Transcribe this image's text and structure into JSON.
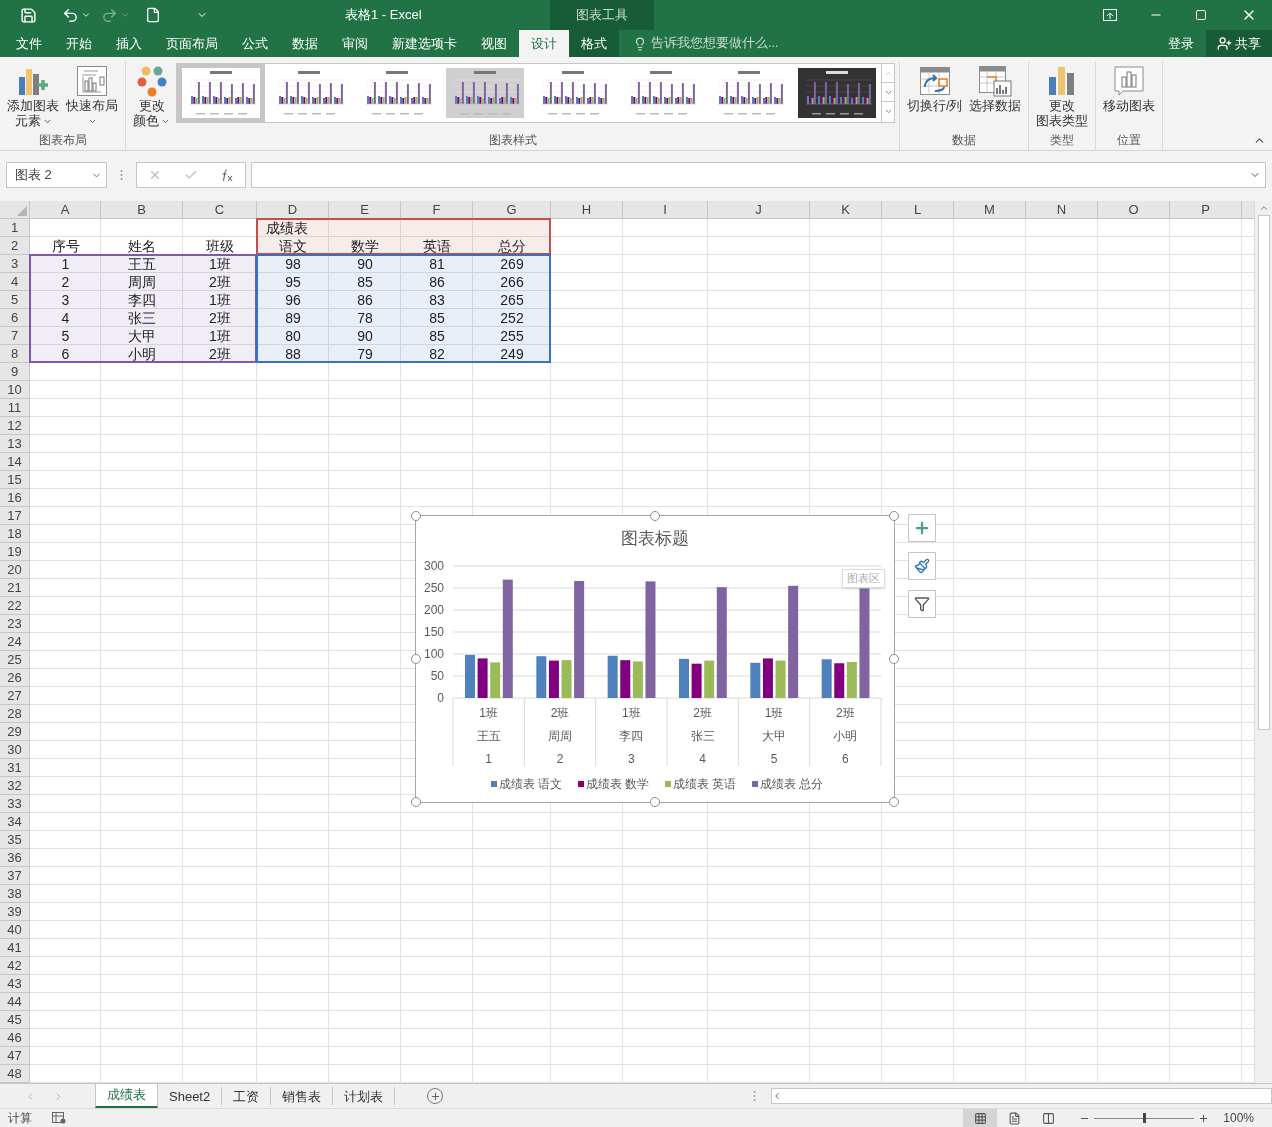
{
  "window": {
    "title": "表格1 - Excel",
    "context_title": "图表工具"
  },
  "ribbon_tabs": [
    {
      "label": "文件",
      "selected": false,
      "kind": "normal"
    },
    {
      "label": "开始",
      "selected": false,
      "kind": "normal"
    },
    {
      "label": "插入",
      "selected": false,
      "kind": "normal"
    },
    {
      "label": "页面布局",
      "selected": false,
      "kind": "normal"
    },
    {
      "label": "公式",
      "selected": false,
      "kind": "normal"
    },
    {
      "label": "数据",
      "selected": false,
      "kind": "normal"
    },
    {
      "label": "审阅",
      "selected": false,
      "kind": "normal"
    },
    {
      "label": "新建选项卡",
      "selected": false,
      "kind": "normal"
    },
    {
      "label": "视图",
      "selected": false,
      "kind": "normal"
    },
    {
      "label": "设计",
      "selected": true,
      "kind": "context"
    },
    {
      "label": "格式",
      "selected": false,
      "kind": "context"
    }
  ],
  "tell_me": {
    "placeholder": "告诉我您想要做什么..."
  },
  "sign_in": "登录",
  "share": "共享",
  "ribbon_groups": [
    {
      "label": "图表布局",
      "buttons": [
        {
          "kind": "add-element",
          "lines": [
            "添加图表",
            "元素"
          ],
          "dropdown": true
        },
        {
          "kind": "quick-layout",
          "lines": [
            "快速布局"
          ],
          "dropdown": true
        }
      ]
    },
    {
      "label": "图表样式",
      "buttons": [
        {
          "kind": "colors",
          "lines": [
            "更改",
            "颜色"
          ],
          "dropdown": true
        }
      ],
      "gallery": [
        {
          "kind": "white",
          "selected": true
        },
        {
          "kind": "white",
          "selected": false
        },
        {
          "kind": "white",
          "selected": false
        },
        {
          "kind": "gray",
          "selected": false
        },
        {
          "kind": "white",
          "selected": false
        },
        {
          "kind": "white",
          "selected": false
        },
        {
          "kind": "white",
          "selected": false
        },
        {
          "kind": "dark",
          "selected": false
        }
      ]
    },
    {
      "label": "数据",
      "buttons": [
        {
          "kind": "switch",
          "lines": [
            "切换行/列"
          ],
          "dropdown": false
        },
        {
          "kind": "select-data",
          "lines": [
            "选择数据"
          ],
          "dropdown": false
        }
      ]
    },
    {
      "label": "类型",
      "buttons": [
        {
          "kind": "chart-type",
          "lines": [
            "更改",
            "图表类型"
          ],
          "dropdown": false
        }
      ]
    },
    {
      "label": "位置",
      "buttons": [
        {
          "kind": "move",
          "lines": [
            "移动图表"
          ],
          "dropdown": false
        }
      ]
    }
  ],
  "name_box": "图表 2",
  "sheet": {
    "columns": [
      "A",
      "B",
      "C",
      "D",
      "E",
      "F",
      "G",
      "H",
      "I",
      "J",
      "K",
      "L",
      "M",
      "N",
      "O",
      "P"
    ],
    "row_numbers": [
      "1",
      "2",
      "3",
      "4",
      "5",
      "6",
      "7",
      "8",
      "9",
      "10",
      "11",
      "12",
      "13",
      "14",
      "15",
      "16",
      "17",
      "18",
      "19",
      "20",
      "21",
      "22",
      "23",
      "24",
      "25",
      "26",
      "27",
      "28",
      "29",
      "30",
      "31",
      "32",
      "33",
      "34",
      "35",
      "36",
      "37",
      "38",
      "39",
      "40",
      "41",
      "42",
      "43",
      "44",
      "45",
      "46",
      "47",
      "48"
    ],
    "title_cell": "成绩表",
    "header": [
      "序号",
      "姓名",
      "班级",
      "语文",
      "数学",
      "英语",
      "总分"
    ],
    "rows": [
      [
        "1",
        "王五",
        "1班",
        "98",
        "90",
        "81",
        "269"
      ],
      [
        "2",
        "周周",
        "2班",
        "95",
        "85",
        "86",
        "266"
      ],
      [
        "3",
        "李四",
        "1班",
        "96",
        "86",
        "83",
        "265"
      ],
      [
        "4",
        "张三",
        "2班",
        "89",
        "78",
        "85",
        "252"
      ],
      [
        "5",
        "大甲",
        "1班",
        "80",
        "90",
        "85",
        "255"
      ],
      [
        "6",
        "小明",
        "2班",
        "88",
        "79",
        "82",
        "249"
      ]
    ]
  },
  "range_highlights": [
    {
      "kind": "series-names",
      "color": "#c0504d"
    },
    {
      "kind": "categories",
      "color": "#7f58b5"
    },
    {
      "kind": "values",
      "color": "#3a6fc4"
    }
  ],
  "chart": {
    "tooltip": "图表区",
    "chart_data": {
      "type": "bar",
      "title": "图表标题",
      "categories": [
        [
          "1班",
          "王五",
          "1"
        ],
        [
          "2班",
          "周周",
          "2"
        ],
        [
          "1班",
          "李四",
          "3"
        ],
        [
          "2班",
          "张三",
          "4"
        ],
        [
          "1班",
          "大甲",
          "5"
        ],
        [
          "2班",
          "小明",
          "6"
        ]
      ],
      "series": [
        {
          "name": "成绩表 语文",
          "color": "#4f81bd",
          "values": [
            98,
            95,
            96,
            89,
            80,
            88
          ]
        },
        {
          "name": "成绩表 数学",
          "color": "#800080",
          "values": [
            90,
            85,
            86,
            78,
            90,
            79
          ]
        },
        {
          "name": "成绩表 英语",
          "color": "#9bbb59",
          "values": [
            81,
            86,
            83,
            85,
            85,
            82
          ]
        },
        {
          "name": "成绩表 总分",
          "color": "#8064a2",
          "values": [
            269,
            266,
            265,
            252,
            255,
            249
          ]
        }
      ],
      "ylim": [
        0,
        300
      ],
      "yticks": [
        0,
        50,
        100,
        150,
        200,
        250,
        300
      ],
      "grid": true,
      "legend": true
    }
  },
  "sheet_tabs": [
    {
      "label": "成绩表",
      "selected": true
    },
    {
      "label": "Sheet2",
      "selected": false
    },
    {
      "label": "工资",
      "selected": false
    },
    {
      "label": "销售表",
      "selected": false
    },
    {
      "label": "计划表",
      "selected": false
    }
  ],
  "status_bar": {
    "mode": "计算",
    "views": [
      {
        "kind": "normal",
        "selected": true
      },
      {
        "kind": "page-layout",
        "selected": false
      },
      {
        "kind": "page-break",
        "selected": false
      }
    ],
    "zoom_slider": {
      "level": 0.5
    },
    "zoom": "100%"
  }
}
